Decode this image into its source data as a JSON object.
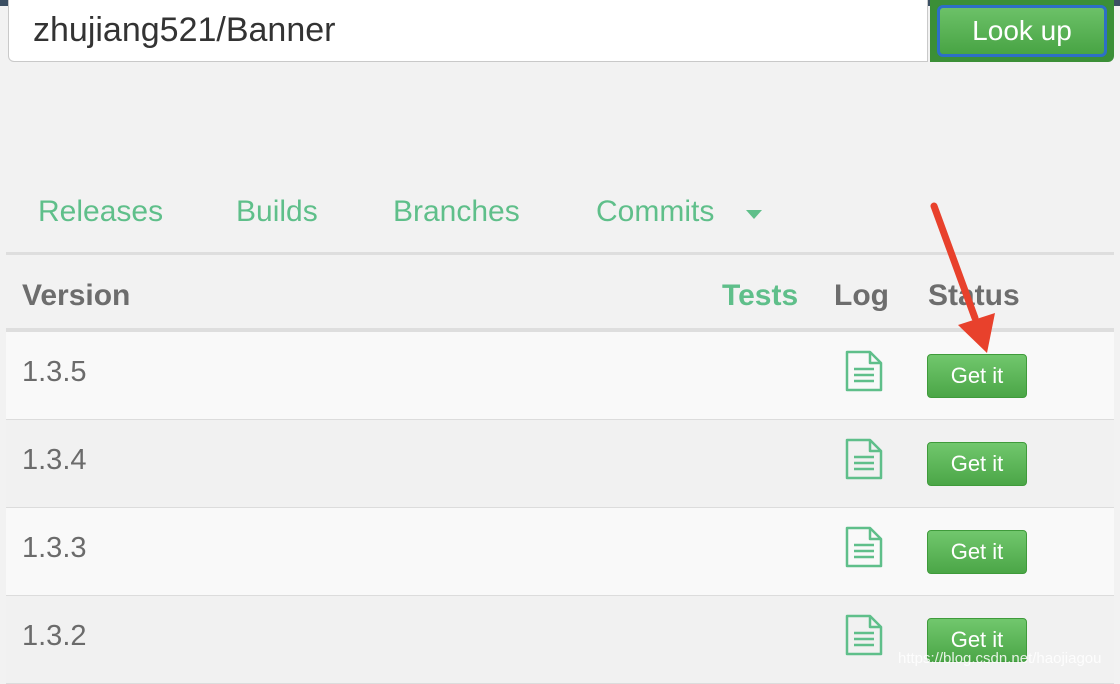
{
  "search": {
    "value": "zhujiang521/Banner",
    "button_label": "Look up"
  },
  "tabs": [
    {
      "label": "Releases"
    },
    {
      "label": "Builds"
    },
    {
      "label": "Branches"
    },
    {
      "label": "Commits"
    }
  ],
  "table": {
    "headers": {
      "version": "Version",
      "tests": "Tests",
      "log": "Log",
      "status": "Status"
    },
    "rows": [
      {
        "version": "1.3.5",
        "action": "Get it"
      },
      {
        "version": "1.3.4",
        "action": "Get it"
      },
      {
        "version": "1.3.3",
        "action": "Get it"
      },
      {
        "version": "1.3.2",
        "action": "Get it"
      }
    ]
  },
  "watermark": "https://blog.csdn.net/haojiagou",
  "colors": {
    "accent_green": "#5fbf8a",
    "button_green": "#4ba647",
    "annotation_red": "#e8412c"
  },
  "icons": {
    "log": "document-icon",
    "tab_dropdown": "caret-down-icon",
    "annotation": "red-arrow-annotation"
  }
}
